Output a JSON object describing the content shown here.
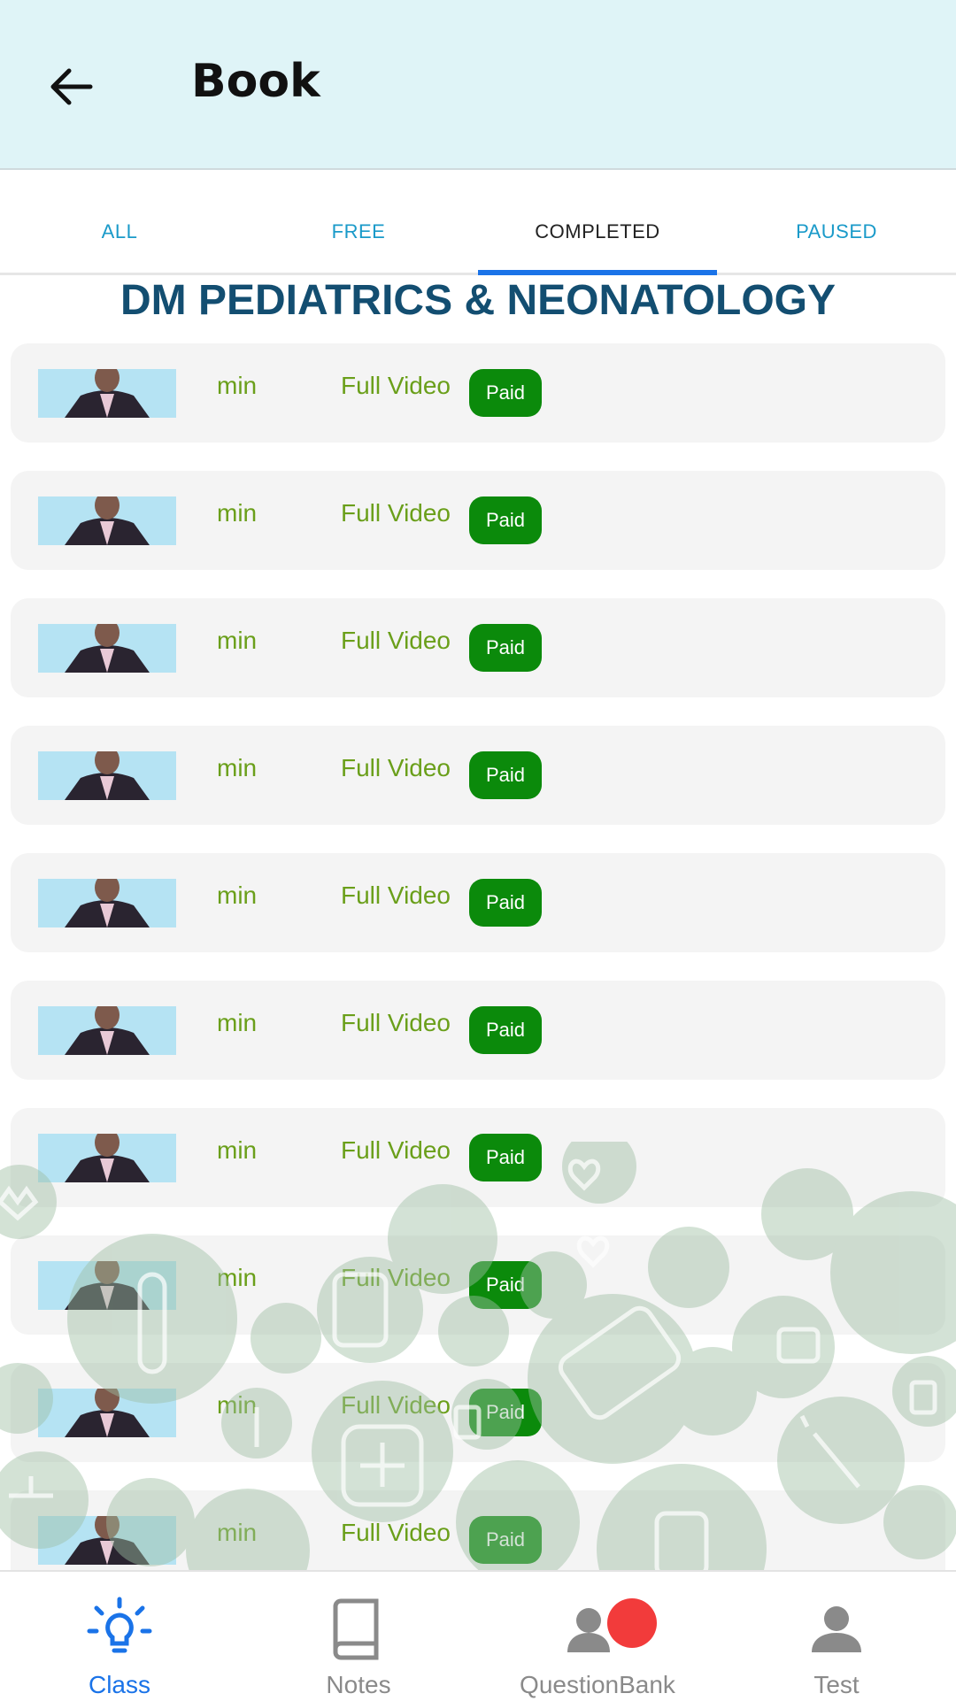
{
  "appbar": {
    "title": "Book"
  },
  "tabs": [
    {
      "label": "ALL",
      "active": false
    },
    {
      "label": "FREE",
      "active": false
    },
    {
      "label": "COMPLETED",
      "active": true
    },
    {
      "label": "PAUSED",
      "active": false
    }
  ],
  "section_title": "DM PEDIATRICS & NEONATOLOGY",
  "rows": [
    {
      "duration": "min",
      "type": "Full Video",
      "badge": "Paid"
    },
    {
      "duration": "min",
      "type": "Full Video",
      "badge": "Paid"
    },
    {
      "duration": "min",
      "type": "Full Video",
      "badge": "Paid"
    },
    {
      "duration": "min",
      "type": "Full Video",
      "badge": "Paid"
    },
    {
      "duration": "min",
      "type": "Full Video",
      "badge": "Paid"
    },
    {
      "duration": "min",
      "type": "Full Video",
      "badge": "Paid"
    },
    {
      "duration": "min",
      "type": "Full Video",
      "badge": "Paid"
    },
    {
      "duration": "min",
      "type": "Full Video",
      "badge": "Paid"
    },
    {
      "duration": "min",
      "type": "Full Video",
      "badge": "Paid"
    },
    {
      "duration": "min",
      "type": "Full Video",
      "badge": "Paid"
    }
  ],
  "bottom_nav": [
    {
      "label": "Class",
      "icon": "lightbulb-icon",
      "active": true
    },
    {
      "label": "Notes",
      "icon": "book-icon",
      "active": false
    },
    {
      "label": "QuestionBank",
      "icon": "person-icon",
      "active": false,
      "notification_dot": true
    },
    {
      "label": "Test",
      "icon": "person-icon",
      "active": false
    }
  ],
  "colors": {
    "appbar_bg": "#dff4f7",
    "tab_text": "#1a9ac9",
    "tab_indicator": "#1a73e8",
    "section_title": "#134e71",
    "row_text": "#6a9f1a",
    "paid_badge": "#0b8a0b",
    "nav_active": "#1a73e8",
    "nav_inactive": "#8a8a8a",
    "notification_dot": "#f23b3b"
  }
}
